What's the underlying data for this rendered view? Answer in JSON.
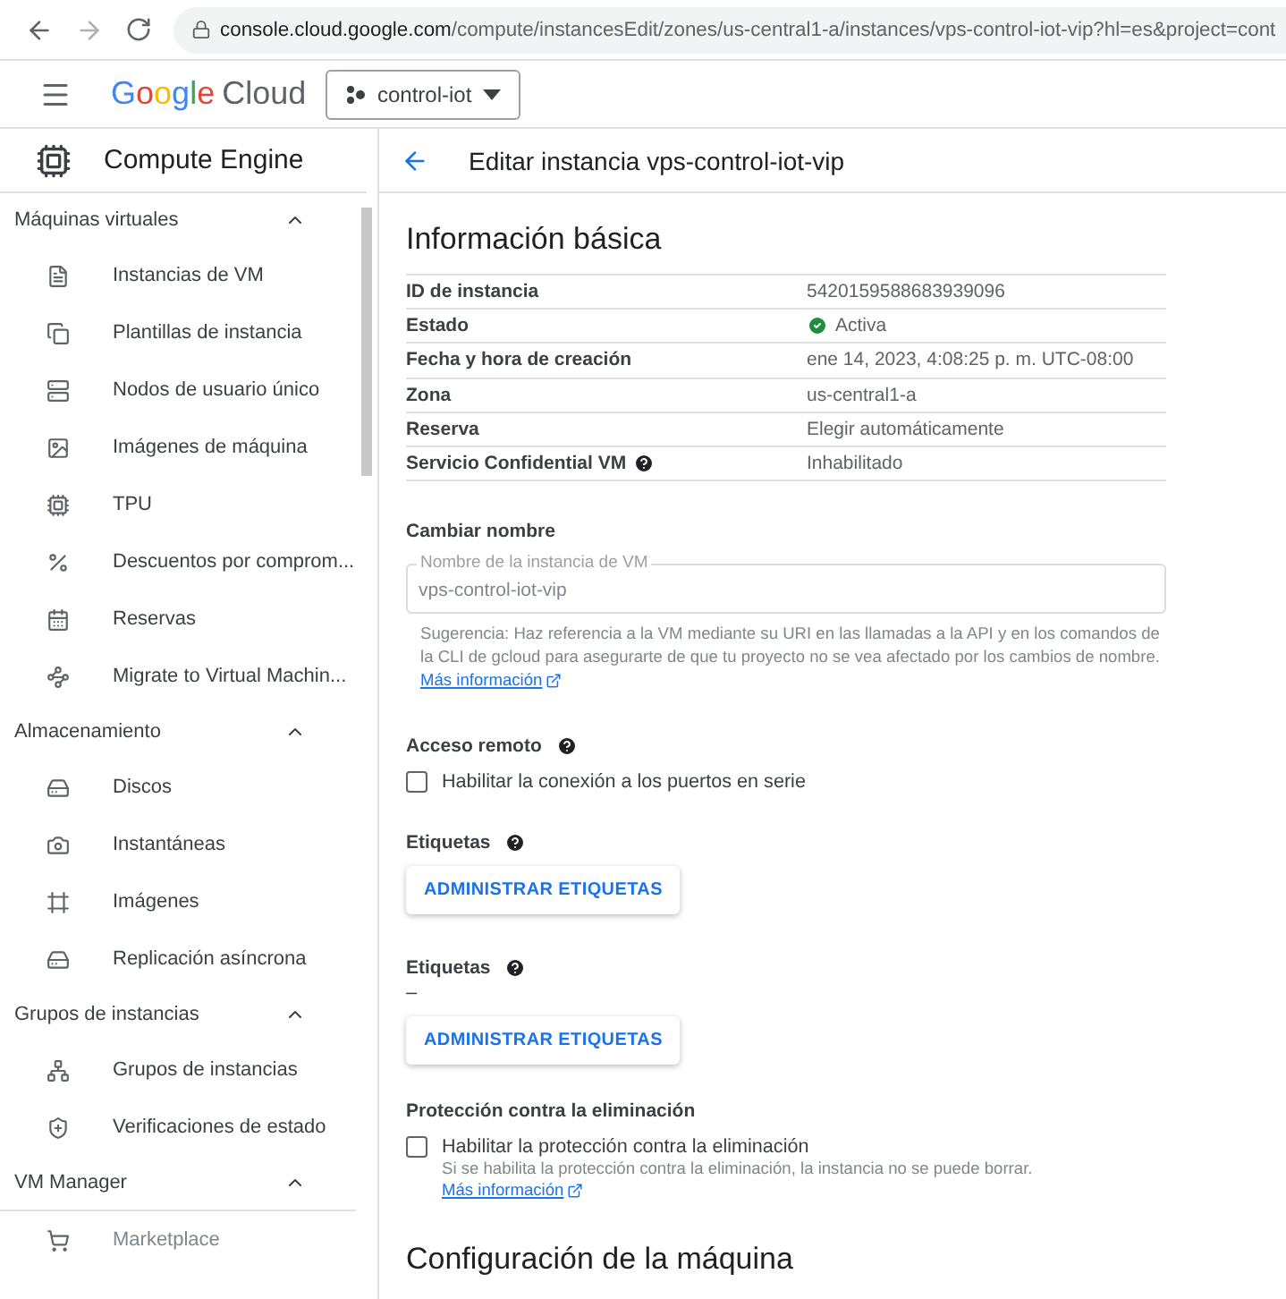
{
  "browser": {
    "url_host": "console.cloud.google.com",
    "url_path": "/compute/instancesEdit/zones/us-central1-a/instances/vps-control-iot-vip?hl=es&project=cont"
  },
  "header": {
    "logo_word": "Google",
    "logo_product": "Cloud",
    "project": "control-iot"
  },
  "sidebar": {
    "product": "Compute Engine",
    "sections": [
      {
        "title": "Máquinas virtuales",
        "expanded": true,
        "items": [
          "Instancias de VM",
          "Plantillas de instancia",
          "Nodos de usuario único",
          "Imágenes de máquina",
          "TPU",
          "Descuentos por comprom...",
          "Reservas",
          "Migrate to Virtual Machin..."
        ]
      },
      {
        "title": "Almacenamiento",
        "expanded": true,
        "items": [
          "Discos",
          "Instantáneas",
          "Imágenes",
          "Replicación asíncrona"
        ]
      },
      {
        "title": "Grupos de instancias",
        "expanded": true,
        "items": [
          "Grupos de instancias",
          "Verificaciones de estado"
        ]
      },
      {
        "title": "VM Manager",
        "expanded": true
      }
    ],
    "footer_item": "Marketplace"
  },
  "page": {
    "title": "Editar instancia vps-control-iot-vip",
    "basic": {
      "heading": "Información básica",
      "rows": [
        {
          "kind": "text",
          "label": "ID de instancia",
          "value": "5420159588683939096",
          "help": false
        },
        {
          "kind": "status",
          "label": "Estado",
          "value": "Activa",
          "help": false
        },
        {
          "kind": "text",
          "label": "Fecha y hora de creación",
          "value": "ene 14, 2023, 4:08:25 p. m. UTC-08:00",
          "help": false
        },
        {
          "kind": "text",
          "label": "Zona",
          "value": "us-central1-a",
          "help": false
        },
        {
          "kind": "text",
          "label": "Reserva",
          "value": "Elegir automáticamente",
          "help": false
        },
        {
          "kind": "text",
          "label": "Servicio Confidential VM",
          "value": "Inhabilitado",
          "help": true
        }
      ]
    },
    "rename": {
      "heading": "Cambiar nombre",
      "field_label": "Nombre de la instancia de VM",
      "value": "vps-control-iot-vip",
      "hint": "Sugerencia: Haz referencia a la VM mediante su URI en las llamadas a la API y en los comandos de la CLI de gcloud para asegurarte de que tu proyecto no se vea afectado por los cambios de nombre.",
      "link": "Más información"
    },
    "remote": {
      "heading": "Acceso remoto",
      "checkbox": {
        "label": "Habilitar la conexión a los puertos en serie",
        "checked": false
      }
    },
    "labels": {
      "heading": "Etiquetas",
      "button": "ADMINISTRAR ETIQUETAS"
    },
    "tags": {
      "heading": "Etiquetas",
      "value": "–",
      "button": "ADMINISTRAR ETIQUETAS"
    },
    "protection": {
      "heading": "Protección contra la eliminación",
      "checkbox": {
        "label": "Habilitar la protección contra la eliminación",
        "checked": false
      },
      "hint": "Si se habilita la protección contra la eliminación, la instancia no se puede borrar.",
      "link": "Más información"
    },
    "machine": {
      "heading": "Configuración de la máquina"
    }
  }
}
